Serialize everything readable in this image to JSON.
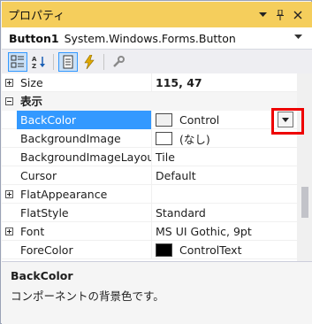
{
  "window": {
    "title": "プロパティ",
    "dropdown_icon": "chevron-down-icon",
    "pin_icon": "pin-icon",
    "close_icon": "close-icon"
  },
  "object_selector": {
    "name": "Button1",
    "type": "System.Windows.Forms.Button"
  },
  "toolbar": {
    "buttons": [
      "categorized-icon",
      "alphabetical-icon",
      "properties-icon",
      "events-icon",
      "property-pages-icon"
    ]
  },
  "grid": {
    "rows": [
      {
        "kind": "property",
        "expander": "plus",
        "name": "Size",
        "value": "115, 47"
      },
      {
        "kind": "category",
        "expander": "minus",
        "name": "表示"
      },
      {
        "kind": "property",
        "name": "BackColor",
        "value": "Control",
        "swatch": "#f0f0f0",
        "selected": true
      },
      {
        "kind": "property",
        "name": "BackgroundImage",
        "value": "(なし)",
        "swatch": "#ffffff"
      },
      {
        "kind": "property",
        "name": "BackgroundImageLayout",
        "value": "Tile"
      },
      {
        "kind": "property",
        "name": "Cursor",
        "value": "Default"
      },
      {
        "kind": "property",
        "expander": "plus",
        "name": "FlatAppearance",
        "value": ""
      },
      {
        "kind": "property",
        "name": "FlatStyle",
        "value": "Standard"
      },
      {
        "kind": "property",
        "expander": "plus",
        "name": "Font",
        "value": "MS UI Gothic, 9pt"
      },
      {
        "kind": "property",
        "name": "ForeColor",
        "value": "ControlText",
        "swatch": "#000000"
      }
    ]
  },
  "description": {
    "title": "BackColor",
    "text": "コンポーネントの背景色です。"
  },
  "colors": {
    "title_bar": "#f5ce5c",
    "selection": "#3399ff",
    "highlight_box": "#ee0000"
  }
}
